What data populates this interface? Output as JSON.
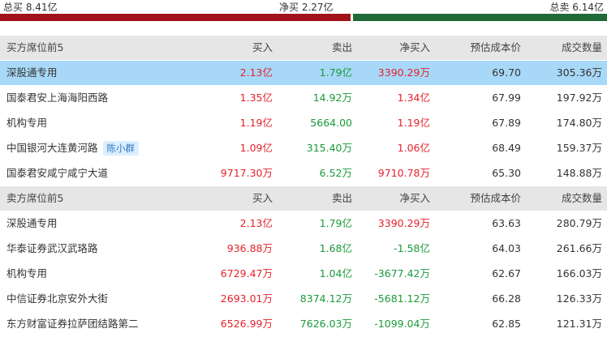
{
  "summary": {
    "total_buy": "总买 8.41亿",
    "net_buy": "净买 2.27亿",
    "total_sell": "总卖 6.14亿"
  },
  "colors": {
    "red": "#e5222b",
    "green": "#1a9a3a",
    "bar_red": "#a1121b",
    "bar_green": "#1f6a37",
    "highlight": "#a8d8f7"
  },
  "buy_section": {
    "headers": [
      "买方席位前5",
      "买入",
      "卖出",
      "净买入",
      "预估成本价",
      "成交数量"
    ],
    "rows": [
      {
        "name": "深股通专用",
        "buy": "2.13亿",
        "sell": "1.79亿",
        "net": "3390.29万",
        "cost": "69.70",
        "volume": "305.36万",
        "tag": ""
      },
      {
        "name": "国泰君安上海海阳西路",
        "buy": "1.35亿",
        "sell": "14.92万",
        "net": "1.34亿",
        "cost": "67.99",
        "volume": "197.92万",
        "tag": ""
      },
      {
        "name": "机构专用",
        "buy": "1.19亿",
        "sell": "5664.00",
        "net": "1.19亿",
        "cost": "67.89",
        "volume": "174.80万",
        "tag": ""
      },
      {
        "name": "中国银河大连黄河路",
        "buy": "1.09亿",
        "sell": "315.40万",
        "net": "1.06亿",
        "cost": "68.49",
        "volume": "159.37万",
        "tag": "陈小群"
      },
      {
        "name": "国泰君安咸宁咸宁大道",
        "buy": "9717.30万",
        "sell": "6.52万",
        "net": "9710.78万",
        "cost": "65.30",
        "volume": "148.88万",
        "tag": ""
      }
    ]
  },
  "sell_section": {
    "headers": [
      "卖方席位前5",
      "买入",
      "卖出",
      "净买入",
      "预估成本价",
      "成交数量"
    ],
    "rows": [
      {
        "name": "深股通专用",
        "buy": "2.13亿",
        "sell": "1.79亿",
        "net": "3390.29万",
        "cost": "63.63",
        "volume": "280.79万"
      },
      {
        "name": "华泰证券武汉武珞路",
        "buy": "936.88万",
        "sell": "1.68亿",
        "net": "-1.58亿",
        "cost": "64.03",
        "volume": "261.66万"
      },
      {
        "name": "机构专用",
        "buy": "6729.47万",
        "sell": "1.04亿",
        "net": "-3677.42万",
        "cost": "62.67",
        "volume": "166.03万"
      },
      {
        "name": "中信证券北京安外大街",
        "buy": "2693.01万",
        "sell": "8374.12万",
        "net": "-5681.12万",
        "cost": "66.28",
        "volume": "126.33万"
      },
      {
        "name": "东方财富证券拉萨团结路第二",
        "buy": "6526.99万",
        "sell": "7626.03万",
        "net": "-1099.04万",
        "cost": "62.85",
        "volume": "121.31万"
      }
    ]
  }
}
